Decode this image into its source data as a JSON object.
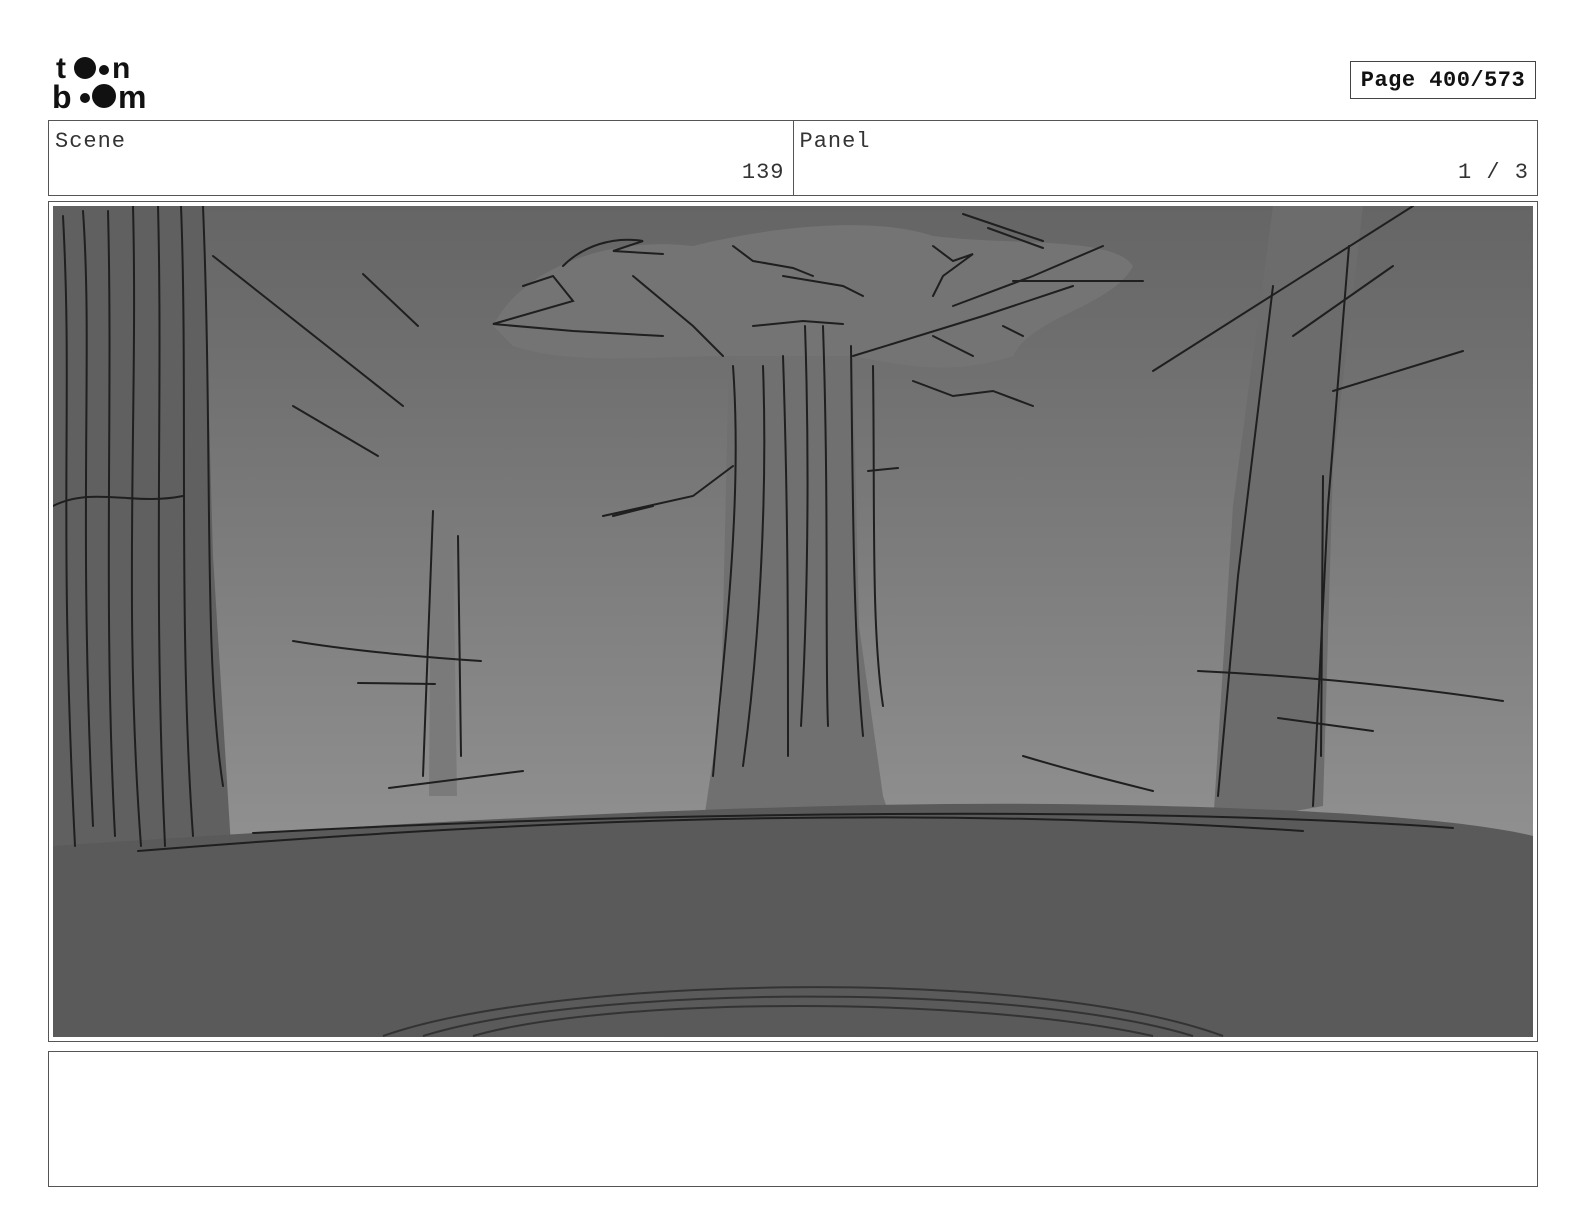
{
  "brand": {
    "logo_alt": "toon boom"
  },
  "page": {
    "indicator": "Page 400/573"
  },
  "scene": {
    "label": "Scene",
    "value": "139"
  },
  "panel": {
    "label": "Panel",
    "value": "1 / 3"
  },
  "notes": {
    "text": ""
  },
  "colors": {
    "sky_top": "#666666",
    "sky_bottom": "#8d8d8d",
    "ground": "#5a5a5a",
    "tree_fill": "#6e6e6e",
    "line": "#222222"
  }
}
